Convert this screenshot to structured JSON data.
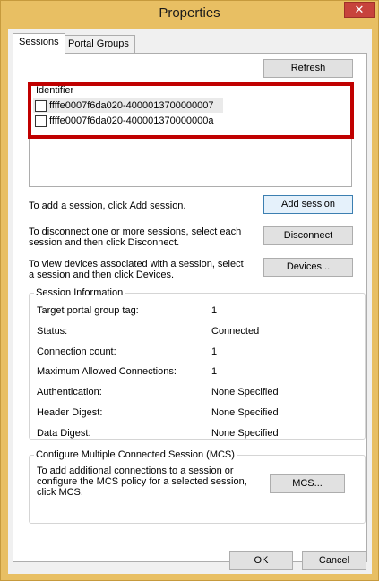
{
  "window": {
    "title": "Properties",
    "close_glyph": "✕"
  },
  "tabs": [
    {
      "label": "Sessions",
      "active": true
    },
    {
      "label": "Portal Groups",
      "active": false
    }
  ],
  "sessions_tab": {
    "refresh_label": "Refresh",
    "list": {
      "column_header": "Identifier",
      "items": [
        {
          "identifier": "ffffe0007f6da020-4000013700000007",
          "checked": false
        },
        {
          "identifier": "ffffe0007f6da020-400001370000000a",
          "checked": false
        }
      ]
    },
    "add_text": "To add a session, click Add session.",
    "add_button": "Add session",
    "disconnect_text_1": "To disconnect one or more sessions, select each",
    "disconnect_text_2": "session and then click Disconnect.",
    "disconnect_button": "Disconnect",
    "devices_text_1": "To view devices associated with a session, select",
    "devices_text_2": "a session and then click Devices.",
    "devices_button": "Devices...",
    "session_info": {
      "title": "Session Information",
      "rows": [
        {
          "label": "Target portal group tag:",
          "value": "1"
        },
        {
          "label": "Status:",
          "value": "Connected"
        },
        {
          "label": "Connection count:",
          "value": "1"
        },
        {
          "label": "Maximum Allowed Connections:",
          "value": "1"
        },
        {
          "label": "Authentication:",
          "value": "None Specified"
        },
        {
          "label": "Header Digest:",
          "value": "None Specified"
        },
        {
          "label": "Data Digest:",
          "value": "None Specified"
        }
      ]
    },
    "mcs": {
      "title": "Configure Multiple Connected Session (MCS)",
      "text_1": "To add additional connections to a session or",
      "text_2": "configure the MCS policy for a selected session,",
      "text_3": "click MCS.",
      "button": "MCS..."
    }
  },
  "footer": {
    "ok_label": "OK",
    "cancel_label": "Cancel"
  },
  "colors": {
    "title_bar": "#e8bf63",
    "close_button": "#c7433c",
    "highlight_border": "#c00000"
  }
}
